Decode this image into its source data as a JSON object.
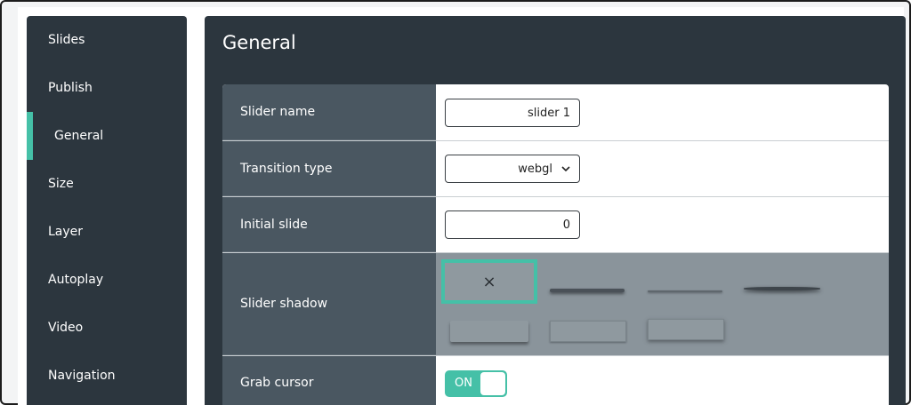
{
  "sidebar": {
    "items": [
      {
        "label": "Slides"
      },
      {
        "label": "Publish"
      },
      {
        "label": "General"
      },
      {
        "label": "Size"
      },
      {
        "label": "Layer"
      },
      {
        "label": "Autoplay"
      },
      {
        "label": "Video"
      },
      {
        "label": "Navigation"
      }
    ],
    "active_index": 2
  },
  "main": {
    "title": "General",
    "fields": {
      "slider_name": {
        "label": "Slider name",
        "value": "slider 1"
      },
      "transition_type": {
        "label": "Transition type",
        "value": "webgl"
      },
      "initial_slide": {
        "label": "Initial slide",
        "value": "0"
      },
      "slider_shadow": {
        "label": "Slider shadow",
        "selected_glyph": "×"
      },
      "grab_cursor": {
        "label": "Grab cursor",
        "state": "ON"
      }
    }
  },
  "colors": {
    "panel": "#2c363e",
    "label_cell": "#4a5761",
    "accent": "#45c0a7",
    "shadow_area": "#8a949b"
  },
  "icons": {
    "dropdown": "chevron-down-icon",
    "no_shadow": "close-icon"
  }
}
